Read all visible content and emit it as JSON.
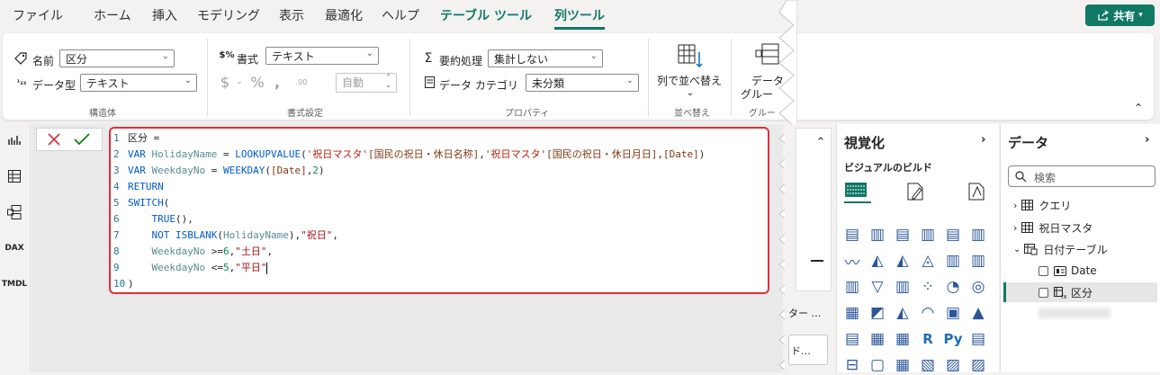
{
  "menubar": {
    "items": [
      {
        "label": "ファイル"
      },
      {
        "label": "ホーム"
      },
      {
        "label": "挿入"
      },
      {
        "label": "モデリング"
      },
      {
        "label": "表示"
      },
      {
        "label": "最適化"
      },
      {
        "label": "ヘルプ"
      },
      {
        "label": "テーブル ツール"
      },
      {
        "label": "列ツール"
      }
    ],
    "share_label": "共有"
  },
  "ribbon": {
    "structure": {
      "name_label": "名前",
      "name_value": "区分",
      "datatype_label": "データ型",
      "datatype_value": "テキスト",
      "group_label": "構造体"
    },
    "format": {
      "format_label": "書式",
      "format_value": "テキスト",
      "auto_value": "自動",
      "group_label": "書式設定"
    },
    "properties": {
      "summarize_label": "要約処理",
      "summarize_value": "集計しない",
      "category_label": "データ カテゴリ",
      "category_value": "未分類",
      "group_label": "プロパティ"
    },
    "sort": {
      "button_label": "列で並べ替え",
      "group_label": "並べ替え"
    },
    "data_groups": {
      "button_label_1": "データ",
      "button_label_2": "グルー",
      "group_label": "グルー"
    }
  },
  "formula": {
    "lines": [
      {
        "n": "1",
        "html": "区分 ="
      },
      {
        "n": "2",
        "html": "<span class=\"kw\">VAR</span> <span class=\"var\">HolidayName</span> = <span class=\"fn\">LOOKUPVALUE</span>(<span class=\"tbl\">'祝日マスタ'</span><span class=\"col\">[国民の祝日・休日名称]</span>,<span class=\"tbl\">'祝日マスタ'</span><span class=\"col\">[国民の祝日・休日月日]</span>,<span class=\"col\">[Date]</span>)"
      },
      {
        "n": "3",
        "html": "<span class=\"kw\">VAR</span> <span class=\"var\">WeekdayNo</span> = <span class=\"fn\">WEEKDAY</span>(<span class=\"col\">[Date]</span>,<span class=\"num\">2</span>)"
      },
      {
        "n": "4",
        "html": "<span class=\"kw\">RETURN</span>"
      },
      {
        "n": "5",
        "html": "<span class=\"fn\">SWITCH</span>("
      },
      {
        "n": "6",
        "html": "    <span class=\"fn\">TRUE</span>(),"
      },
      {
        "n": "7",
        "html": "    <span class=\"kw\">NOT</span> <span class=\"fn\">ISBLANK</span>(<span class=\"var\">HolidayName</span>),<span class=\"str\">\"祝日\"</span>,"
      },
      {
        "n": "8",
        "html": "    <span class=\"var\">WeekdayNo</span> >=<span class=\"num\">6</span>,<span class=\"str\">\"土日\"</span>,"
      },
      {
        "n": "9",
        "html": "    <span class=\"var\">WeekdayNo</span> <=<span class=\"num\">5</span>,<span class=\"str\">\"平日\"</span><span class=\"caret\"></span>"
      },
      {
        "n": "10",
        "html": ")"
      }
    ]
  },
  "midpanel": {
    "label_1": "ター …",
    "label_2": "ド…"
  },
  "visualizations": {
    "title": "視覚化",
    "subtitle": "ビジュアルのビルド"
  },
  "data_pane": {
    "title": "データ",
    "search_placeholder": "検索",
    "tables": [
      {
        "label": "クエリ"
      },
      {
        "label": "祝日マスタ"
      },
      {
        "label": "日付テーブル"
      }
    ],
    "fields": [
      {
        "label": "Date"
      },
      {
        "label": "区分"
      }
    ]
  },
  "colors": {
    "accent": "#117865",
    "error_border": "#e0303a"
  }
}
